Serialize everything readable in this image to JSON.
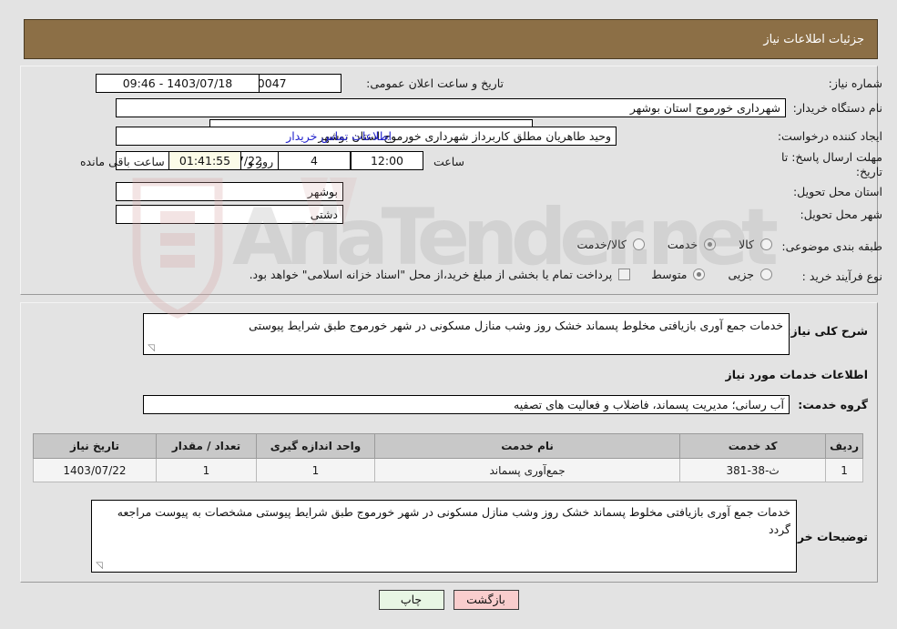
{
  "header": {
    "title": "جزئیات اطلاعات نیاز"
  },
  "colors": {
    "header_bg": "#8c6f46",
    "page_bg": "#e3e3e3",
    "link": "#2222cc",
    "countdown_bg": "#fbfbe8",
    "btn_back_bg": "#f9cdcd",
    "btn_print_bg": "#e8f6e4",
    "table_header_bg": "#c8c8c8"
  },
  "form": {
    "need_number": {
      "label": "شماره نیاز:",
      "value": "1103050079000047"
    },
    "announce_datetime": {
      "label": "تاریخ و ساعت اعلان عمومی:",
      "value": "1403/07/18 - 09:46"
    },
    "buyer_org": {
      "label": "نام دستگاه خریدار:",
      "value": "شهرداری خورموج استان بوشهر"
    },
    "empty_field": {
      "label": "",
      "value": ""
    },
    "request_creator": {
      "label": "ایجاد کننده درخواست:",
      "value": "وحید طاهریان مطلق کاربرداز شهرداری خورموج استان بوشهر"
    },
    "contact_link": {
      "label": "اطلاعات تماس خریدار"
    },
    "deadline": {
      "label": "مهلت ارسال پاسخ: تا تاریخ:",
      "value": "1403/07/22"
    },
    "deadline_hour": {
      "label": "ساعت",
      "value": "12:00"
    },
    "days_remaining": {
      "value": "4",
      "suffix": "روز و"
    },
    "countdown": {
      "value": "01:41:55",
      "suffix": "ساعت باقی مانده"
    },
    "delivery_province": {
      "label": "استان محل تحویل:",
      "value": "بوشهر"
    },
    "delivery_city": {
      "label": "شهر محل تحویل:",
      "value": "دشتی"
    },
    "subject_category": {
      "label": "طبقه بندی موضوعی:",
      "options": [
        {
          "label": "کالا",
          "selected": false
        },
        {
          "label": "خدمت",
          "selected": true
        },
        {
          "label": "کالا/خدمت",
          "selected": false
        }
      ]
    },
    "purchase_process": {
      "label": "نوع فرآیند خرید :",
      "options": [
        {
          "label": "جزیی",
          "selected": false
        },
        {
          "label": "متوسط",
          "selected": true
        }
      ],
      "checkbox": {
        "checked": false,
        "note": "پرداخت تمام یا بخشی از مبلغ خرید،از محل \"اسناد خزانه اسلامی\" خواهد بود."
      }
    }
  },
  "description": {
    "general_need": {
      "label": "شرح کلی نیاز:",
      "value": "خدمات جمع آوری بازیافتی مخلوط پسماند خشک روز وشب منازل مسکونی در شهر خورموج طبق شرایط پیوستی"
    },
    "services_info_title": "اطلاعات خدمات مورد نیاز",
    "service_group": {
      "label": "گروه خدمت:",
      "value": "آب رسانی؛ مدیریت پسماند، فاضلاب و فعالیت های تصفیه"
    },
    "buyer_notes": {
      "label": "توضیحات خریدار:",
      "value": "خدمات جمع آوری بازیافتی مخلوط پسماند خشک روز وشب منازل مسکونی در شهر خورموج طبق شرایط پیوستی مشخصات به پیوست مراجعه گردد"
    }
  },
  "table": {
    "columns": [
      "ردیف",
      "کد خدمت",
      "نام خدمت",
      "واحد اندازه گیری",
      "تعداد / مقدار",
      "تاریخ نیاز"
    ],
    "rows": [
      {
        "row_no": "1",
        "service_code": "ث-38-381",
        "service_name": "جمع‌آوری پسماند",
        "unit": "1",
        "quantity": "1",
        "need_date": "1403/07/22"
      }
    ]
  },
  "footer": {
    "back_button": "بازگشت",
    "print_button": "چاپ"
  }
}
